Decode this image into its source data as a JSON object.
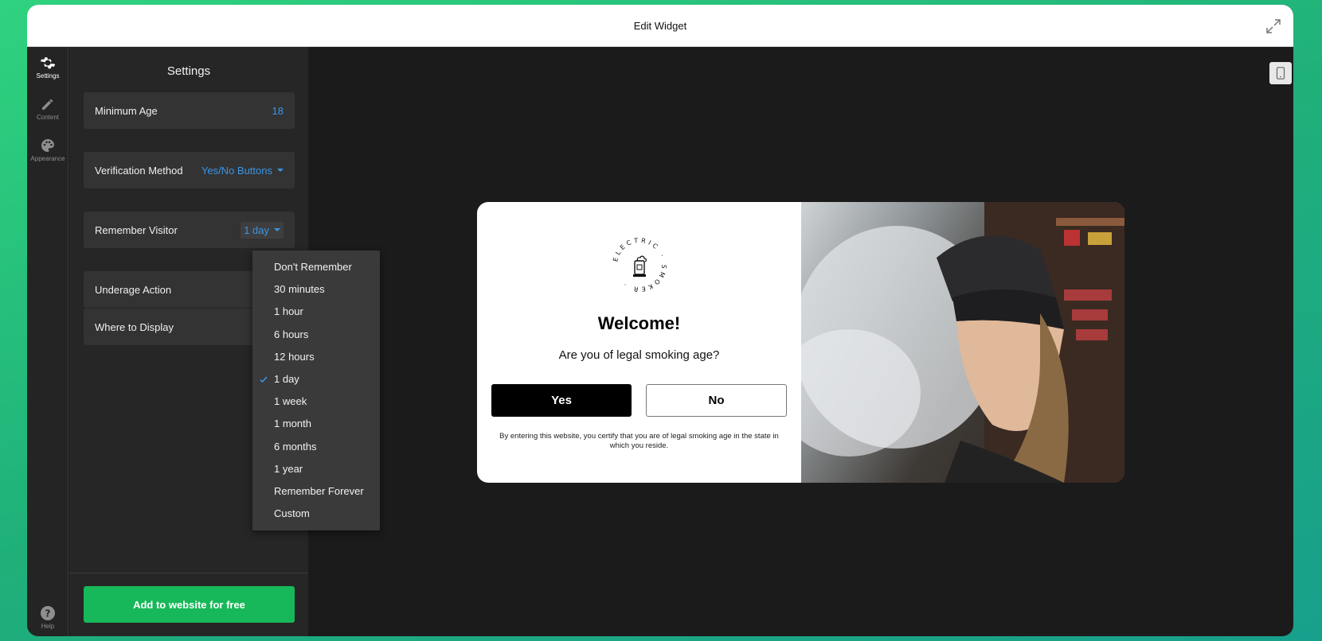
{
  "topbar": {
    "title": "Edit Widget",
    "expand_icon": "expand-icon"
  },
  "rail": {
    "items": [
      {
        "label": "Settings",
        "icon": "gear-icon",
        "active": true
      },
      {
        "label": "Content",
        "icon": "pencil-icon",
        "active": false
      },
      {
        "label": "Appearance",
        "icon": "palette-icon",
        "active": false
      }
    ],
    "help_label": "Help"
  },
  "panel": {
    "title": "Settings",
    "rows": [
      {
        "label": "Minimum Age",
        "value": "18"
      },
      {
        "label": "Verification Method",
        "value": "Yes/No Buttons"
      },
      {
        "label": "Remember Visitor",
        "value": "1 day"
      },
      {
        "label": "Underage Action",
        "value": ""
      },
      {
        "label": "Where to Display",
        "value": ""
      }
    ],
    "add_button": "Add to website for free"
  },
  "dropdown": {
    "options": [
      "Don't Remember",
      "30 minutes",
      "1 hour",
      "6 hours",
      "12 hours",
      "1 day",
      "1 week",
      "1 month",
      "6 months",
      "1 year",
      "Remember Forever",
      "Custom"
    ],
    "selected": "1 day"
  },
  "preview": {
    "logo_text": "ELECTRIC SMOKER",
    "heading": "Welcome!",
    "question": "Are you of legal smoking age?",
    "yes_label": "Yes",
    "no_label": "No",
    "disclaimer": "By entering this website, you certify that you are of legal smoking age in the state in which you reside.",
    "device_icon": "mobile-icon"
  },
  "colors": {
    "accent": "#3b95e8",
    "cta": "#17b859",
    "panel_bg": "#262626",
    "canvas_bg": "#1b1b1b"
  }
}
